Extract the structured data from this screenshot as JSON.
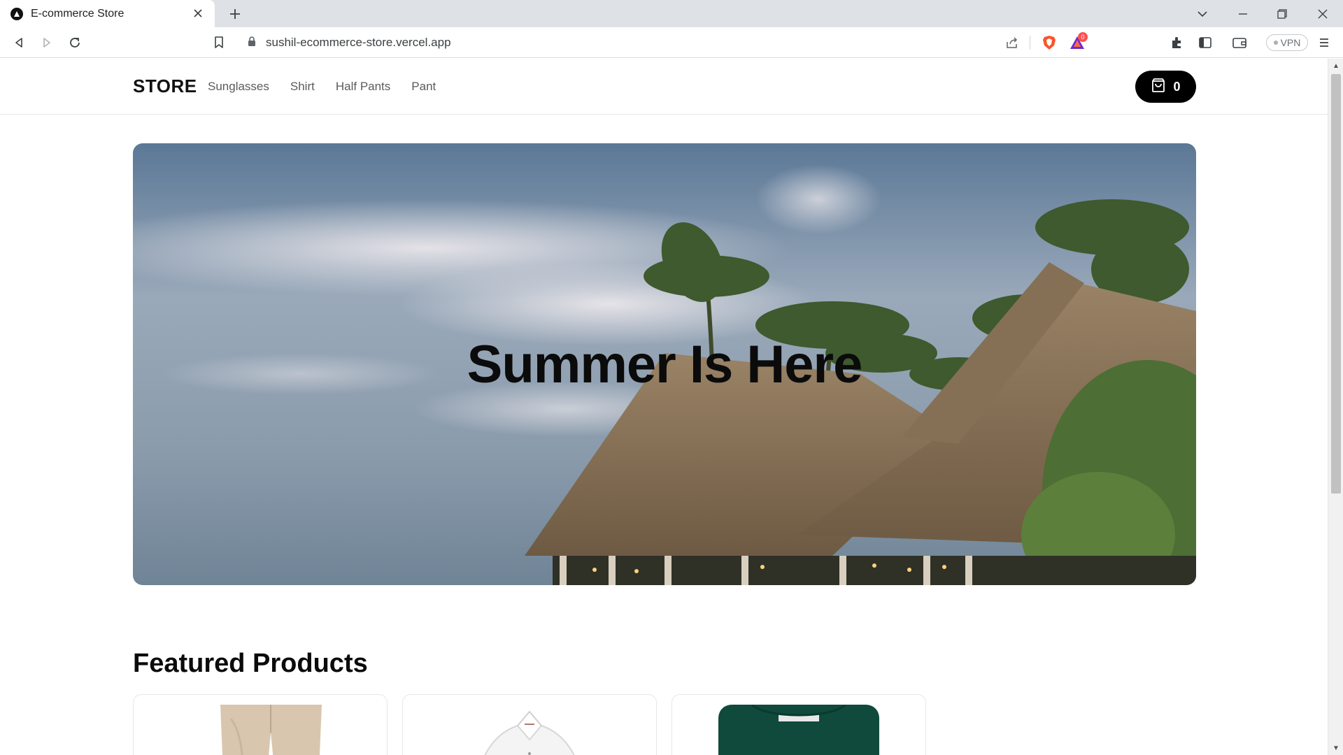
{
  "browser": {
    "tab_title": "E-commerce Store",
    "url": "sushil-ecommerce-store.vercel.app",
    "vpn_label": "VPN",
    "rewards_badge": "0"
  },
  "site": {
    "logo": "STORE",
    "nav": [
      "Sunglasses",
      "Shirt",
      "Half Pants",
      "Pant"
    ],
    "cart_count": "0"
  },
  "hero": {
    "title": "Summer Is Here"
  },
  "featured": {
    "title": "Featured Products",
    "products": [
      {
        "image": "beige-pants"
      },
      {
        "image": "white-shirt"
      },
      {
        "image": "green-shirt"
      }
    ]
  },
  "colors": {
    "accent": "#000000",
    "brave_orange": "#fb542b"
  }
}
